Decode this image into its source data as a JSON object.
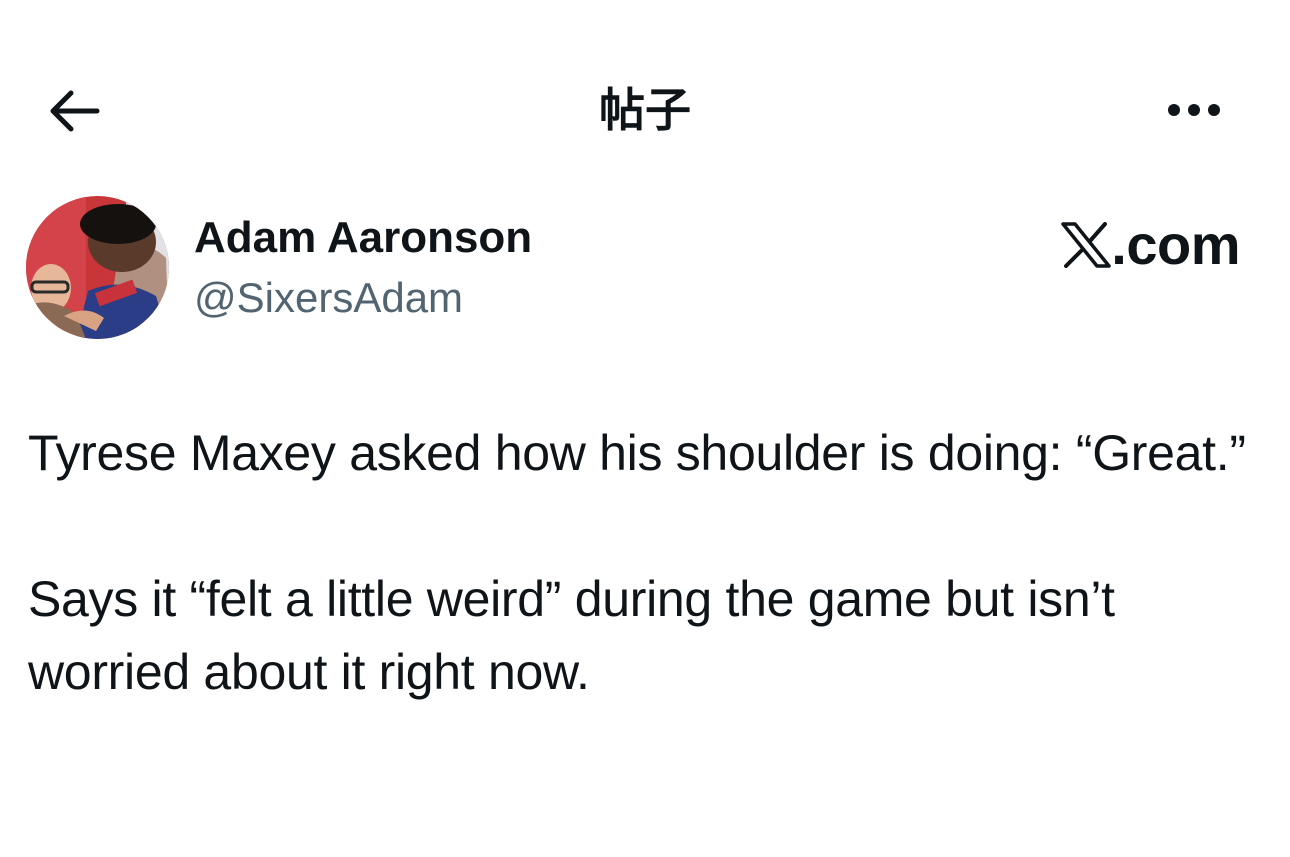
{
  "header": {
    "title": "帖子",
    "back_icon": "arrow-left-icon",
    "more_icon": "ellipsis-icon"
  },
  "author": {
    "name": "Adam Aaronson",
    "handle": "@SixersAdam",
    "avatar": "avatar-photo"
  },
  "brand": {
    "label": ".com",
    "logo_icon": "x-logo-icon"
  },
  "post": {
    "paragraphs": [
      "Tyrese Maxey asked how his shoulder is doing: “Great.”",
      "Says it “felt a little weird” during the game but isn’t worried about it right now."
    ]
  },
  "colors": {
    "text": "#0f1419",
    "secondary": "#536471",
    "background": "#ffffff"
  }
}
